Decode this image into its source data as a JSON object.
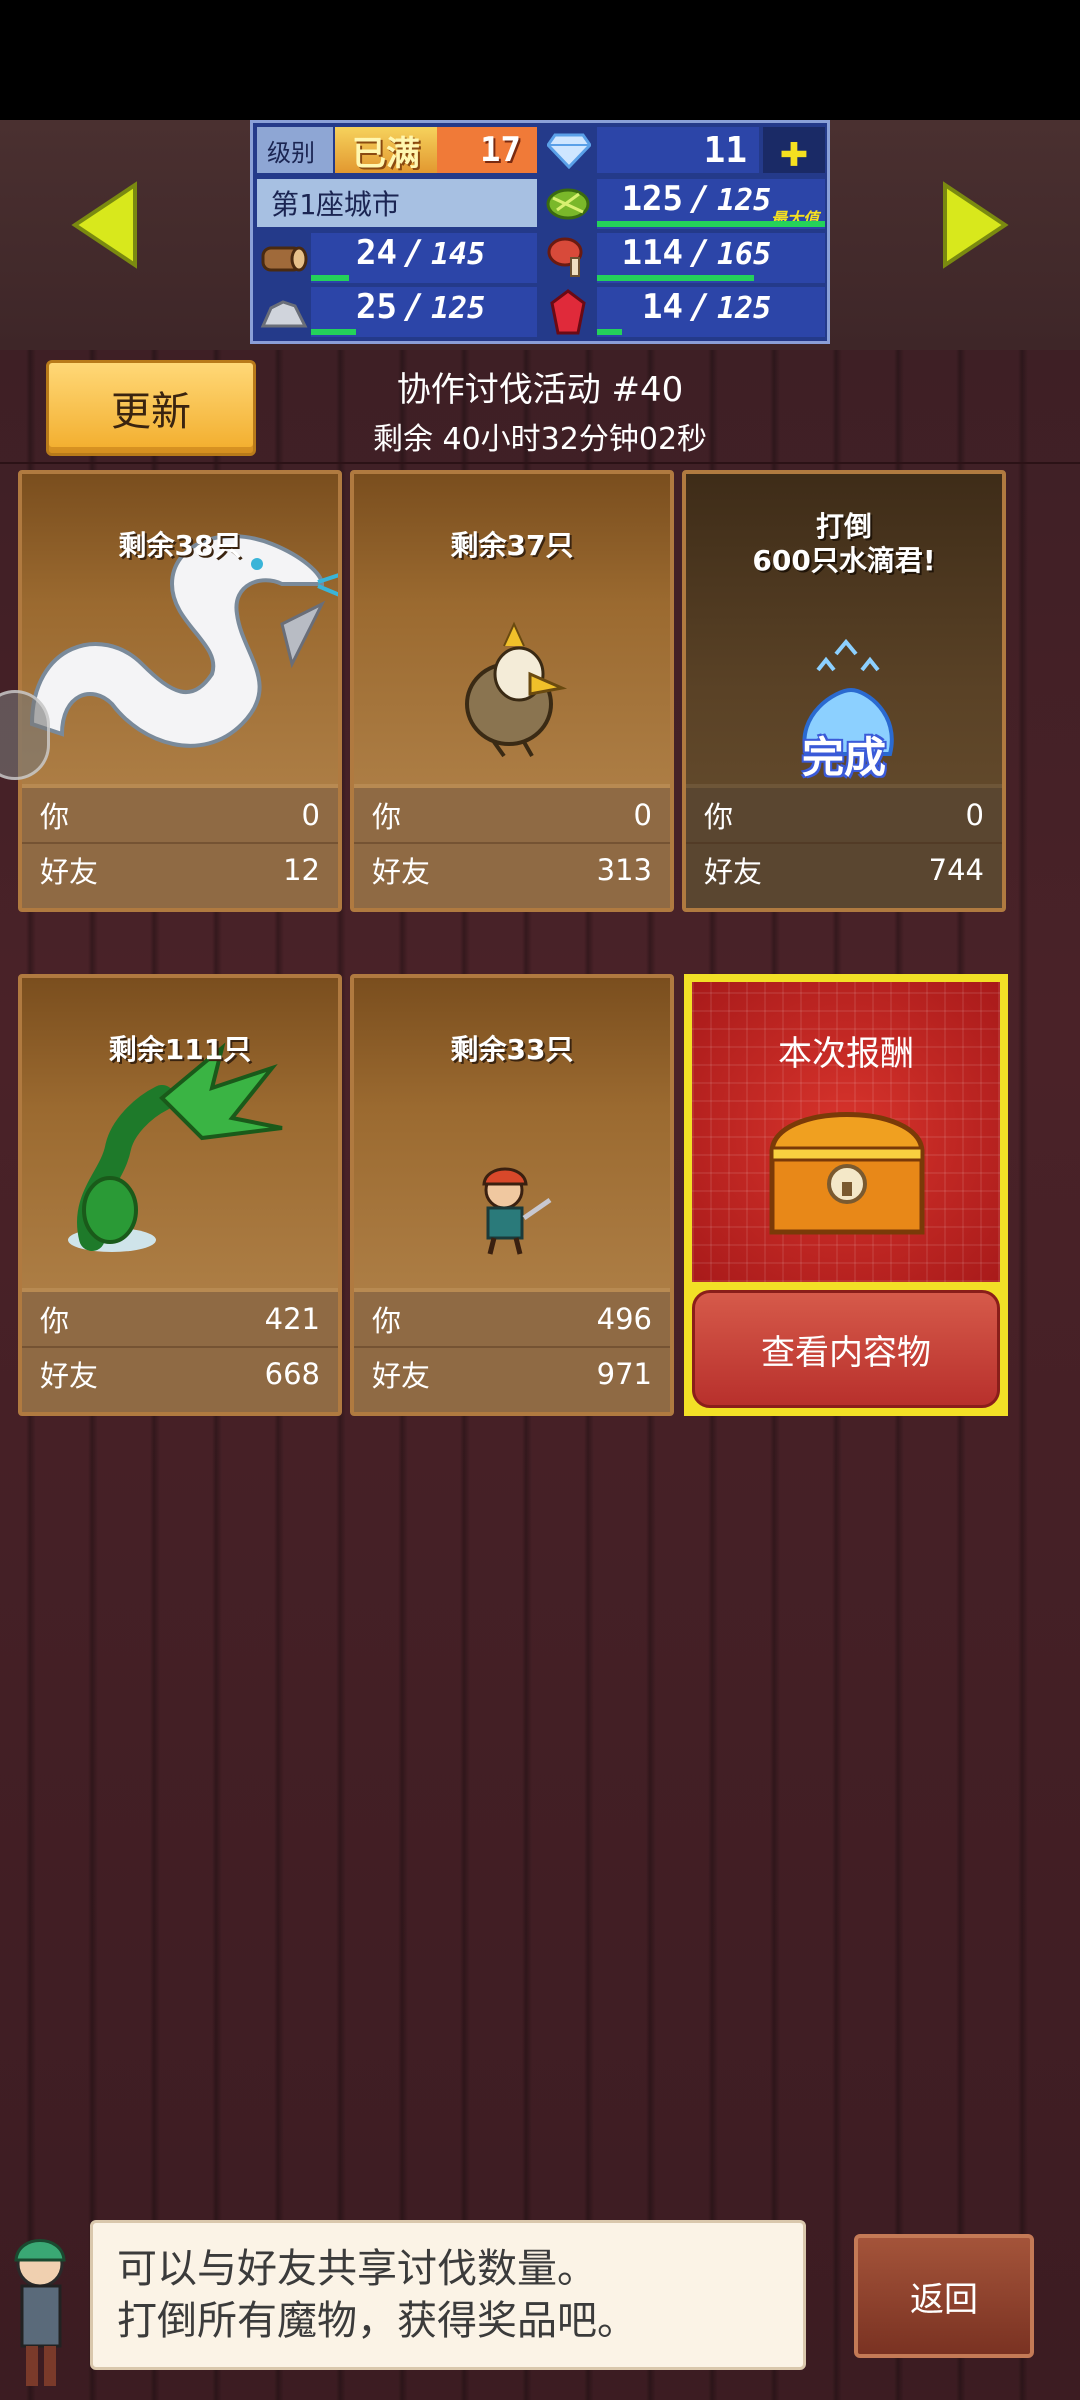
{
  "status": {
    "level_label": "级别",
    "level_max": "已满",
    "level": "17",
    "gems": "11",
    "plus": "✚",
    "city": "第1座城市",
    "food": {
      "current": "125",
      "max": "125",
      "tag": "最大值",
      "fill": 1.0
    },
    "wood": {
      "current": "24",
      "max": "145",
      "fill": 0.166
    },
    "meat": {
      "current": "114",
      "max": "165",
      "fill": 0.69
    },
    "stone": {
      "current": "25",
      "max": "125",
      "fill": 0.2
    },
    "ruby": {
      "current": "14",
      "max": "125",
      "fill": 0.11
    }
  },
  "header": {
    "update_label": "更新",
    "event_title": "协作讨伐活动 #40",
    "remaining": "剩余 40小时32分钟02秒"
  },
  "stat_labels": {
    "you": "你",
    "friends": "好友"
  },
  "cards": [
    {
      "remain": "剩余38只",
      "you": "0",
      "friends": "12",
      "monster": "white-snake-icon"
    },
    {
      "remain": "剩余37只",
      "you": "0",
      "friends": "313",
      "monster": "eagle-icon"
    },
    {
      "goal_line1": "打倒",
      "goal_line2": "600只水滴君!",
      "done": "完成",
      "you": "0",
      "friends": "744",
      "monster": "water-drop-icon"
    },
    {
      "remain": "剩余111只",
      "you": "421",
      "friends": "668",
      "monster": "plant-icon"
    },
    {
      "remain": "剩余33只",
      "you": "496",
      "friends": "971",
      "monster": "pirate-icon"
    }
  ],
  "reward": {
    "title": "本次报酬",
    "view_label": "查看内容物"
  },
  "tip": {
    "line1": "可以与好友共享讨伐数量。",
    "line2": "打倒所有魔物，获得奖品吧。"
  },
  "back_label": "返回",
  "colors": {
    "accent_yellow": "#f2e026",
    "panel_blue": "#243a8a",
    "bar_green": "#24d25a",
    "reward_red": "#c42a24"
  }
}
